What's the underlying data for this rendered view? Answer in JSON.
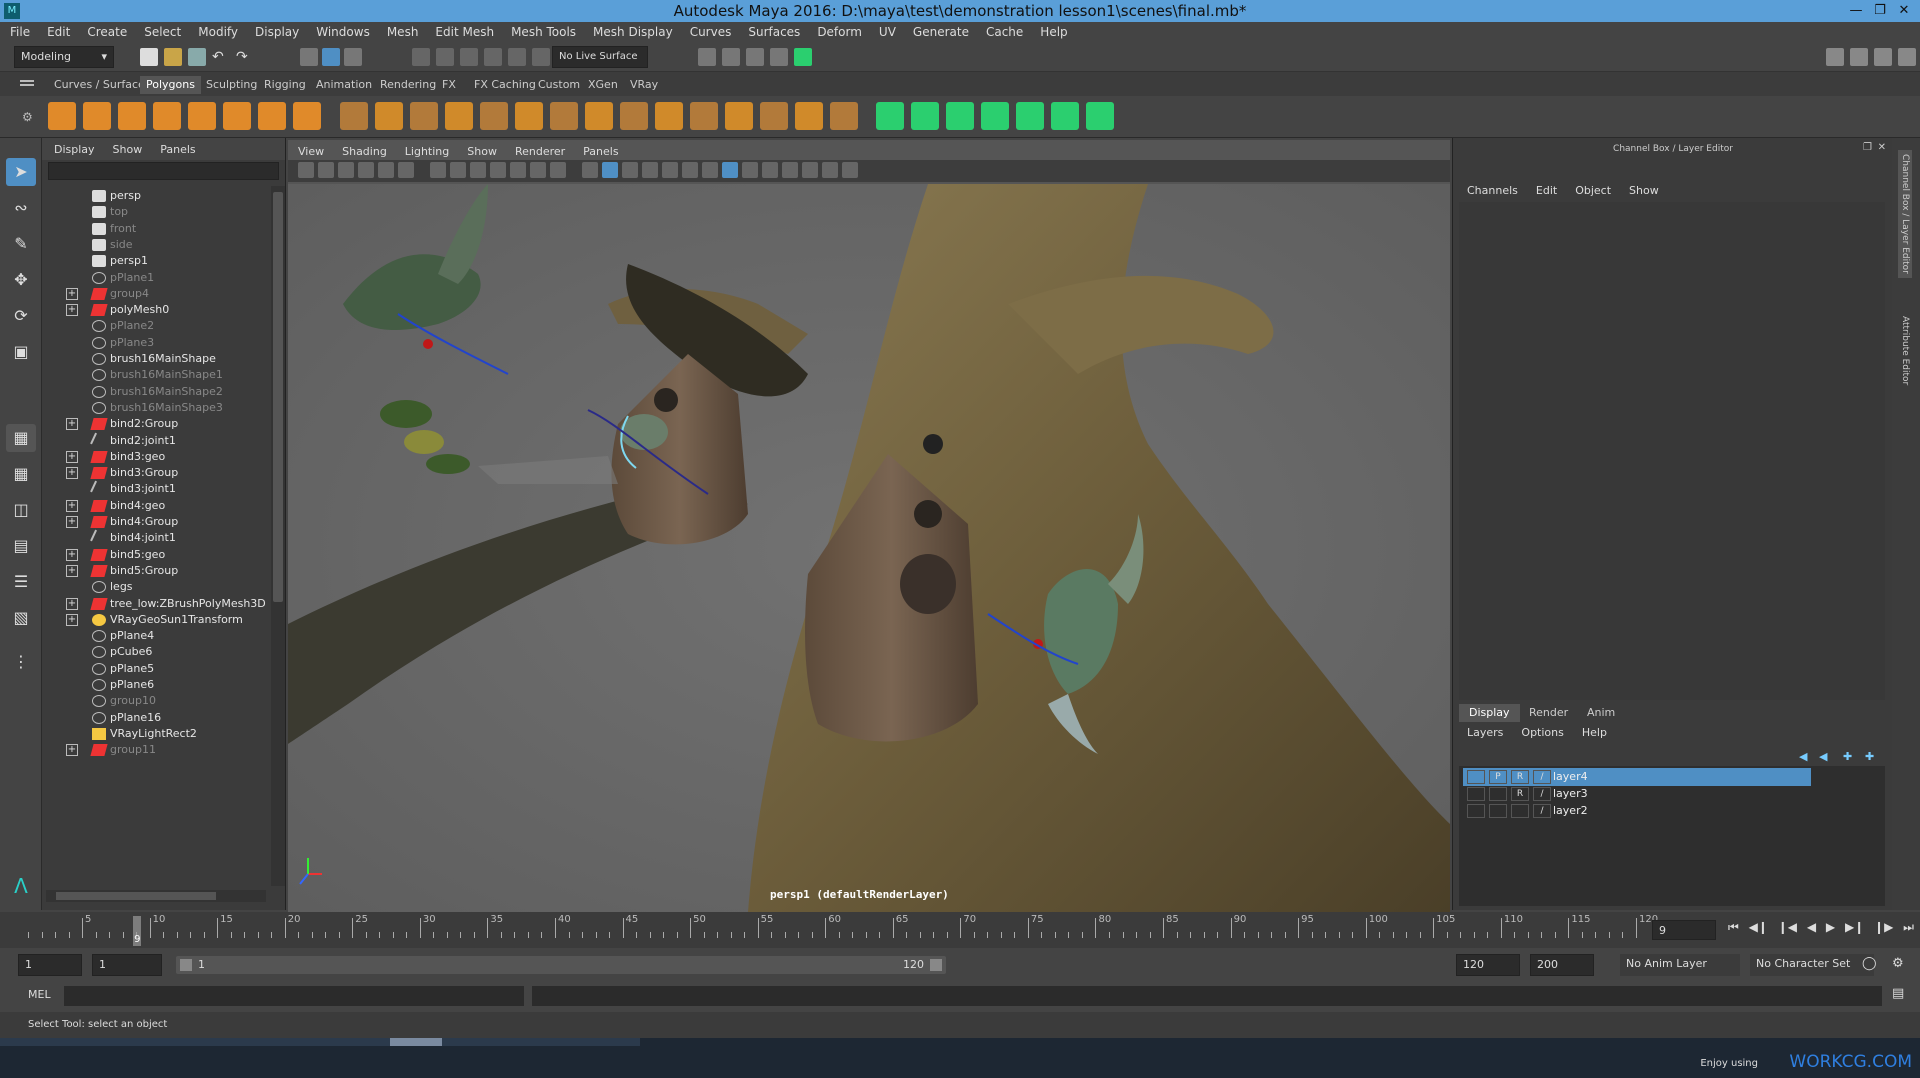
{
  "window": {
    "title": "Autodesk Maya 2016: D:\\maya\\test\\demonstration lesson1\\scenes\\final.mb*"
  },
  "menubar": [
    "File",
    "Edit",
    "Create",
    "Select",
    "Modify",
    "Display",
    "Windows",
    "Mesh",
    "Edit Mesh",
    "Mesh Tools",
    "Mesh Display",
    "Curves",
    "Surfaces",
    "Deform",
    "UV",
    "Generate",
    "Cache",
    "Help"
  ],
  "statusline": {
    "mode": "Modeling",
    "live_surface": "No Live Surface"
  },
  "shelf_tabs": [
    "Curves / Surfaces",
    "Polygons",
    "Sculpting",
    "Rigging",
    "Animation",
    "Rendering",
    "FX",
    "FX Caching",
    "Custom",
    "XGen",
    "VRay"
  ],
  "shelf_active": "Polygons",
  "outliner": {
    "menu": [
      "Display",
      "Show",
      "Panels"
    ],
    "items": [
      {
        "name": "persp",
        "type": "camera",
        "expand": false,
        "dim": false
      },
      {
        "name": "top",
        "type": "camera",
        "expand": false,
        "dim": true
      },
      {
        "name": "front",
        "type": "camera",
        "expand": false,
        "dim": true
      },
      {
        "name": "side",
        "type": "camera",
        "expand": false,
        "dim": true
      },
      {
        "name": "persp1",
        "type": "camera",
        "expand": false,
        "dim": false
      },
      {
        "name": "pPlane1",
        "type": "mesh",
        "expand": false,
        "dim": true
      },
      {
        "name": "group4",
        "type": "group",
        "expand": true,
        "dim": true
      },
      {
        "name": "polyMesh0",
        "type": "group",
        "expand": true,
        "dim": false
      },
      {
        "name": "pPlane2",
        "type": "mesh",
        "expand": false,
        "dim": true
      },
      {
        "name": "pPlane3",
        "type": "mesh",
        "expand": false,
        "dim": true
      },
      {
        "name": "brush16MainShape",
        "type": "mesh",
        "expand": false,
        "dim": false
      },
      {
        "name": "brush16MainShape1",
        "type": "mesh",
        "expand": false,
        "dim": true
      },
      {
        "name": "brush16MainShape2",
        "type": "mesh",
        "expand": false,
        "dim": true
      },
      {
        "name": "brush16MainShape3",
        "type": "mesh",
        "expand": false,
        "dim": true
      },
      {
        "name": "bind2:Group",
        "type": "group",
        "expand": true,
        "dim": false
      },
      {
        "name": "bind2:joint1",
        "type": "joint",
        "expand": false,
        "dim": false
      },
      {
        "name": "bind3:geo",
        "type": "group",
        "expand": true,
        "dim": false
      },
      {
        "name": "bind3:Group",
        "type": "group",
        "expand": true,
        "dim": false
      },
      {
        "name": "bind3:joint1",
        "type": "joint",
        "expand": false,
        "dim": false
      },
      {
        "name": "bind4:geo",
        "type": "group",
        "expand": true,
        "dim": false
      },
      {
        "name": "bind4:Group",
        "type": "group",
        "expand": true,
        "dim": false
      },
      {
        "name": "bind4:joint1",
        "type": "joint",
        "expand": false,
        "dim": false
      },
      {
        "name": "bind5:geo",
        "type": "group",
        "expand": true,
        "dim": false
      },
      {
        "name": "bind5:Group",
        "type": "group",
        "expand": true,
        "dim": false
      },
      {
        "name": "legs",
        "type": "mesh",
        "expand": false,
        "dim": false
      },
      {
        "name": "tree_low:ZBrushPolyMesh3D",
        "type": "group",
        "expand": true,
        "dim": false
      },
      {
        "name": "VRayGeoSun1Transform",
        "type": "sun",
        "expand": true,
        "dim": false
      },
      {
        "name": "pPlane4",
        "type": "mesh",
        "expand": false,
        "dim": false
      },
      {
        "name": "pCube6",
        "type": "mesh",
        "expand": false,
        "dim": false
      },
      {
        "name": "pPlane5",
        "type": "mesh",
        "expand": false,
        "dim": false
      },
      {
        "name": "pPlane6",
        "type": "mesh",
        "expand": false,
        "dim": false
      },
      {
        "name": "group10",
        "type": "mesh",
        "expand": false,
        "dim": true
      },
      {
        "name": "pPlane16",
        "type": "mesh",
        "expand": false,
        "dim": false
      },
      {
        "name": "VRayLightRect2",
        "type": "light",
        "expand": false,
        "dim": false
      },
      {
        "name": "group11",
        "type": "group",
        "expand": true,
        "dim": true
      }
    ]
  },
  "viewport": {
    "menu": [
      "View",
      "Shading",
      "Lighting",
      "Show",
      "Renderer",
      "Panels"
    ],
    "camera_label": "persp1 (defaultRenderLayer)"
  },
  "channelbox": {
    "title": "Channel Box / Layer Editor",
    "menu": [
      "Channels",
      "Edit",
      "Object",
      "Show"
    ],
    "layer_tabs": [
      "Display",
      "Render",
      "Anim"
    ],
    "layer_tab_active": "Display",
    "layer_menu": [
      "Layers",
      "Options",
      "Help"
    ],
    "layers": [
      {
        "name": "layer4",
        "p": "P",
        "r": "R",
        "selected": true
      },
      {
        "name": "layer3",
        "p": "",
        "r": "R",
        "selected": false
      },
      {
        "name": "layer2",
        "p": "",
        "r": "",
        "selected": false
      }
    ]
  },
  "sidetabs": [
    "Channel Box / Layer Editor",
    "Attribute Editor"
  ],
  "timeline": {
    "ticks": [
      "5",
      "10",
      "15",
      "20",
      "25",
      "30",
      "35",
      "40",
      "45",
      "50",
      "55",
      "60",
      "65",
      "70",
      "75",
      "80",
      "85",
      "90",
      "95",
      "100",
      "105",
      "110",
      "115",
      "120"
    ],
    "current_frame": "9",
    "current_frame_field": "9"
  },
  "range": {
    "start": "1",
    "playback_start": "1",
    "range_start_label": "1",
    "range_end_label": "120",
    "playback_end": "120",
    "end": "200",
    "anim_layer": "No Anim Layer",
    "character_set": "No Character Set"
  },
  "cmdline": {
    "label": "MEL"
  },
  "helpline": {
    "text": "Select Tool: select an object"
  },
  "taskbar": {
    "enjoy": "Enjoy using",
    "watermark": "WORKCG.COM"
  },
  "colors": {
    "title_bg": "#5a9fd8",
    "accent_green": "#2bcf6f",
    "selection": "#4f8fc4",
    "shelf_orange": "#e08a2a"
  }
}
